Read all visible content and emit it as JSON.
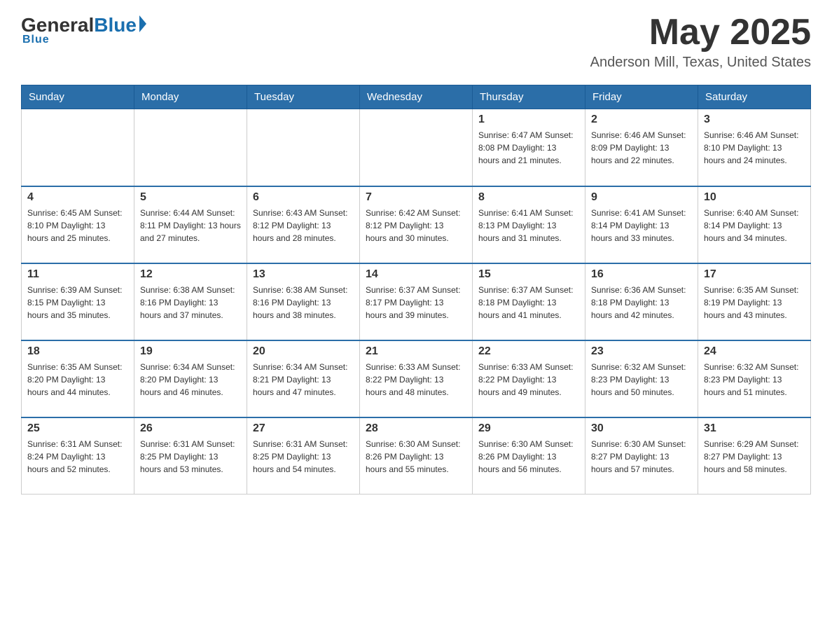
{
  "logo": {
    "general": "General",
    "blue": "Blue",
    "tagline": "Blue"
  },
  "title": {
    "month_year": "May 2025",
    "location": "Anderson Mill, Texas, United States"
  },
  "days_of_week": [
    "Sunday",
    "Monday",
    "Tuesday",
    "Wednesday",
    "Thursday",
    "Friday",
    "Saturday"
  ],
  "weeks": [
    [
      {
        "day": "",
        "info": ""
      },
      {
        "day": "",
        "info": ""
      },
      {
        "day": "",
        "info": ""
      },
      {
        "day": "",
        "info": ""
      },
      {
        "day": "1",
        "info": "Sunrise: 6:47 AM\nSunset: 8:08 PM\nDaylight: 13 hours and 21 minutes."
      },
      {
        "day": "2",
        "info": "Sunrise: 6:46 AM\nSunset: 8:09 PM\nDaylight: 13 hours and 22 minutes."
      },
      {
        "day": "3",
        "info": "Sunrise: 6:46 AM\nSunset: 8:10 PM\nDaylight: 13 hours and 24 minutes."
      }
    ],
    [
      {
        "day": "4",
        "info": "Sunrise: 6:45 AM\nSunset: 8:10 PM\nDaylight: 13 hours and 25 minutes."
      },
      {
        "day": "5",
        "info": "Sunrise: 6:44 AM\nSunset: 8:11 PM\nDaylight: 13 hours and 27 minutes."
      },
      {
        "day": "6",
        "info": "Sunrise: 6:43 AM\nSunset: 8:12 PM\nDaylight: 13 hours and 28 minutes."
      },
      {
        "day": "7",
        "info": "Sunrise: 6:42 AM\nSunset: 8:12 PM\nDaylight: 13 hours and 30 minutes."
      },
      {
        "day": "8",
        "info": "Sunrise: 6:41 AM\nSunset: 8:13 PM\nDaylight: 13 hours and 31 minutes."
      },
      {
        "day": "9",
        "info": "Sunrise: 6:41 AM\nSunset: 8:14 PM\nDaylight: 13 hours and 33 minutes."
      },
      {
        "day": "10",
        "info": "Sunrise: 6:40 AM\nSunset: 8:14 PM\nDaylight: 13 hours and 34 minutes."
      }
    ],
    [
      {
        "day": "11",
        "info": "Sunrise: 6:39 AM\nSunset: 8:15 PM\nDaylight: 13 hours and 35 minutes."
      },
      {
        "day": "12",
        "info": "Sunrise: 6:38 AM\nSunset: 8:16 PM\nDaylight: 13 hours and 37 minutes."
      },
      {
        "day": "13",
        "info": "Sunrise: 6:38 AM\nSunset: 8:16 PM\nDaylight: 13 hours and 38 minutes."
      },
      {
        "day": "14",
        "info": "Sunrise: 6:37 AM\nSunset: 8:17 PM\nDaylight: 13 hours and 39 minutes."
      },
      {
        "day": "15",
        "info": "Sunrise: 6:37 AM\nSunset: 8:18 PM\nDaylight: 13 hours and 41 minutes."
      },
      {
        "day": "16",
        "info": "Sunrise: 6:36 AM\nSunset: 8:18 PM\nDaylight: 13 hours and 42 minutes."
      },
      {
        "day": "17",
        "info": "Sunrise: 6:35 AM\nSunset: 8:19 PM\nDaylight: 13 hours and 43 minutes."
      }
    ],
    [
      {
        "day": "18",
        "info": "Sunrise: 6:35 AM\nSunset: 8:20 PM\nDaylight: 13 hours and 44 minutes."
      },
      {
        "day": "19",
        "info": "Sunrise: 6:34 AM\nSunset: 8:20 PM\nDaylight: 13 hours and 46 minutes."
      },
      {
        "day": "20",
        "info": "Sunrise: 6:34 AM\nSunset: 8:21 PM\nDaylight: 13 hours and 47 minutes."
      },
      {
        "day": "21",
        "info": "Sunrise: 6:33 AM\nSunset: 8:22 PM\nDaylight: 13 hours and 48 minutes."
      },
      {
        "day": "22",
        "info": "Sunrise: 6:33 AM\nSunset: 8:22 PM\nDaylight: 13 hours and 49 minutes."
      },
      {
        "day": "23",
        "info": "Sunrise: 6:32 AM\nSunset: 8:23 PM\nDaylight: 13 hours and 50 minutes."
      },
      {
        "day": "24",
        "info": "Sunrise: 6:32 AM\nSunset: 8:23 PM\nDaylight: 13 hours and 51 minutes."
      }
    ],
    [
      {
        "day": "25",
        "info": "Sunrise: 6:31 AM\nSunset: 8:24 PM\nDaylight: 13 hours and 52 minutes."
      },
      {
        "day": "26",
        "info": "Sunrise: 6:31 AM\nSunset: 8:25 PM\nDaylight: 13 hours and 53 minutes."
      },
      {
        "day": "27",
        "info": "Sunrise: 6:31 AM\nSunset: 8:25 PM\nDaylight: 13 hours and 54 minutes."
      },
      {
        "day": "28",
        "info": "Sunrise: 6:30 AM\nSunset: 8:26 PM\nDaylight: 13 hours and 55 minutes."
      },
      {
        "day": "29",
        "info": "Sunrise: 6:30 AM\nSunset: 8:26 PM\nDaylight: 13 hours and 56 minutes."
      },
      {
        "day": "30",
        "info": "Sunrise: 6:30 AM\nSunset: 8:27 PM\nDaylight: 13 hours and 57 minutes."
      },
      {
        "day": "31",
        "info": "Sunrise: 6:29 AM\nSunset: 8:27 PM\nDaylight: 13 hours and 58 minutes."
      }
    ]
  ]
}
